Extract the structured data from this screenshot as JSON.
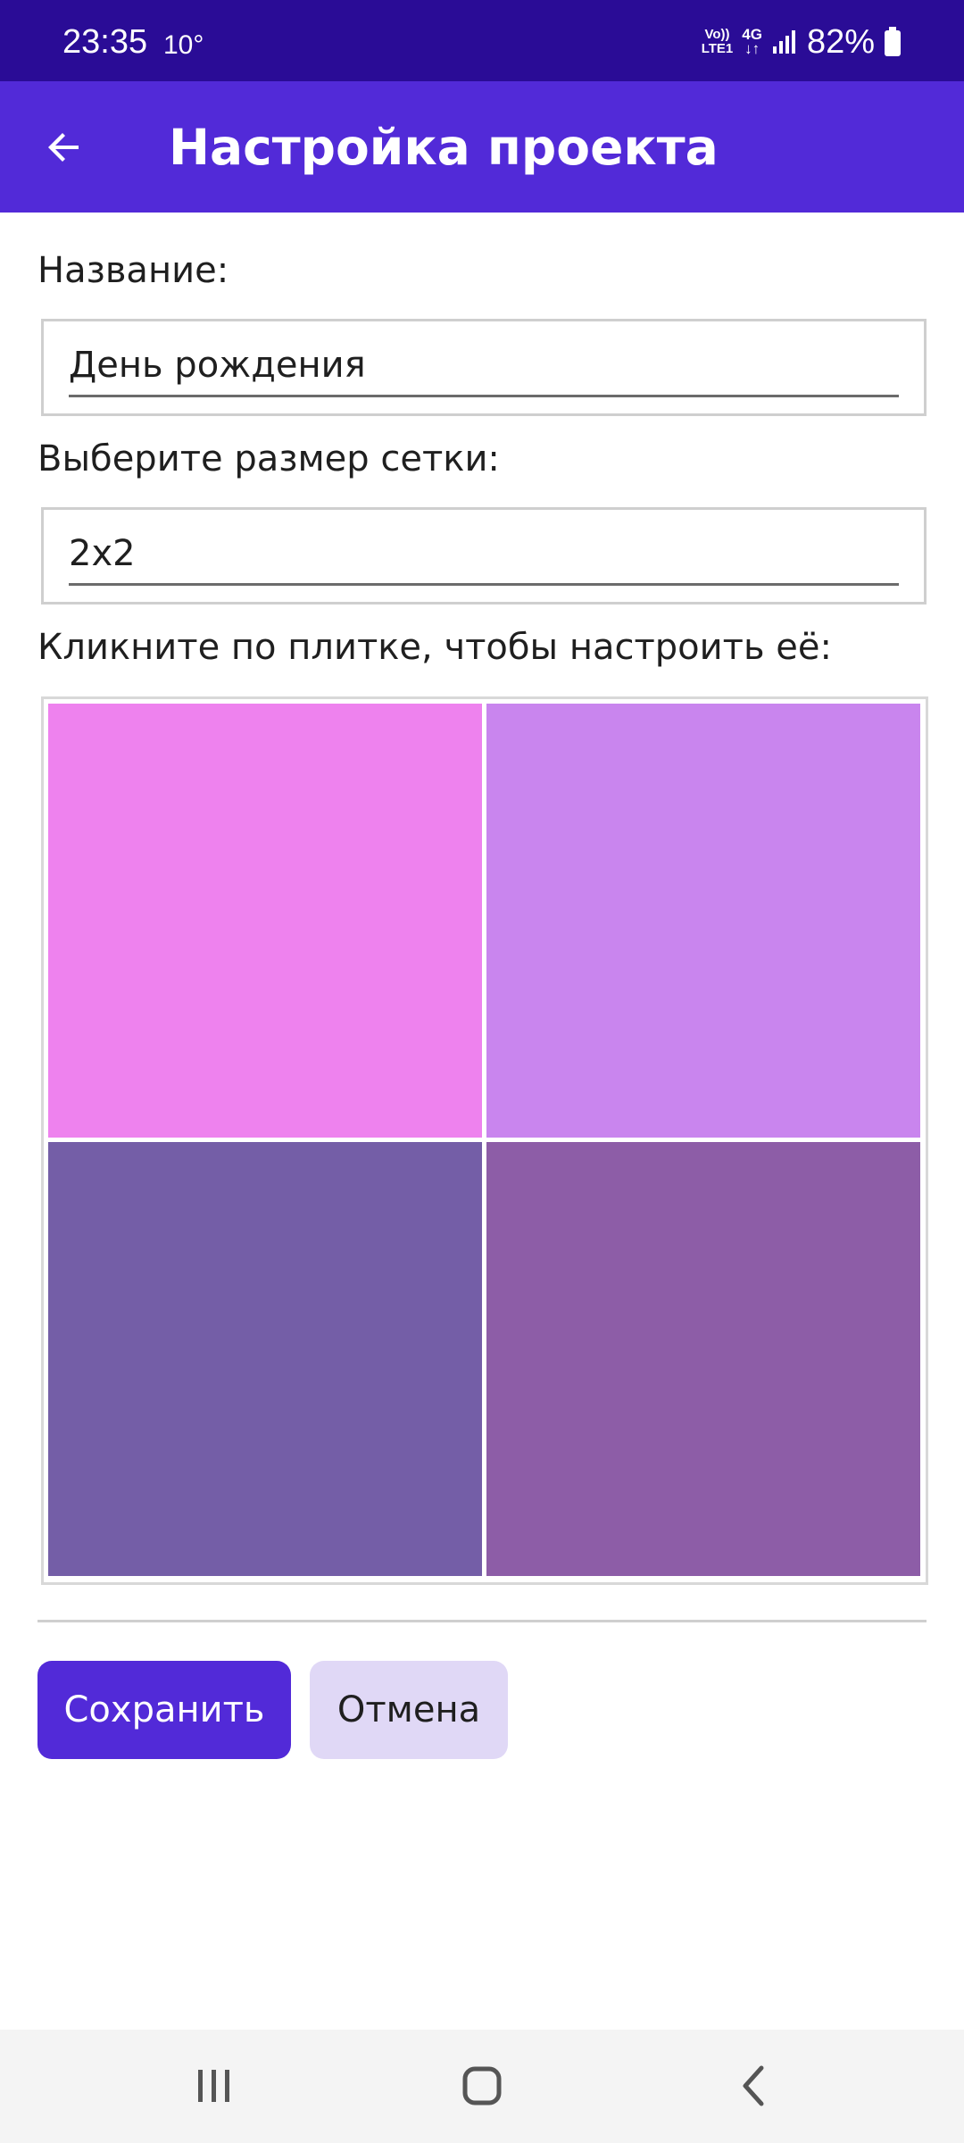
{
  "status_bar": {
    "time": "23:35",
    "temperature": "10°",
    "volte_line1": "Vo))",
    "volte_line2": "LTE1",
    "network": "4G",
    "battery": "82%"
  },
  "app_bar": {
    "title": "Настройка проекта",
    "back_icon": "arrow-left-icon"
  },
  "form": {
    "name_label": "Название:",
    "name_value": "День рождения",
    "grid_label": "Выберите размер сетки:",
    "grid_value": "2x2",
    "tiles_label": "Кликните по плитке, чтобы настроить её:"
  },
  "tiles": [
    {
      "color": "#ee82ee"
    },
    {
      "color": "#c985ee"
    },
    {
      "color": "#745ea7"
    },
    {
      "color": "#8d5da7"
    }
  ],
  "actions": {
    "save_label": "Сохранить",
    "cancel_label": "Отмена"
  },
  "colors": {
    "status_bar": "#2a0c96",
    "app_bar": "#522ad8",
    "primary_button": "#522ad8",
    "secondary_button": "#e0d8f6"
  },
  "nav_bar": {
    "icons": [
      "recent-apps-icon",
      "home-icon",
      "back-icon"
    ]
  }
}
